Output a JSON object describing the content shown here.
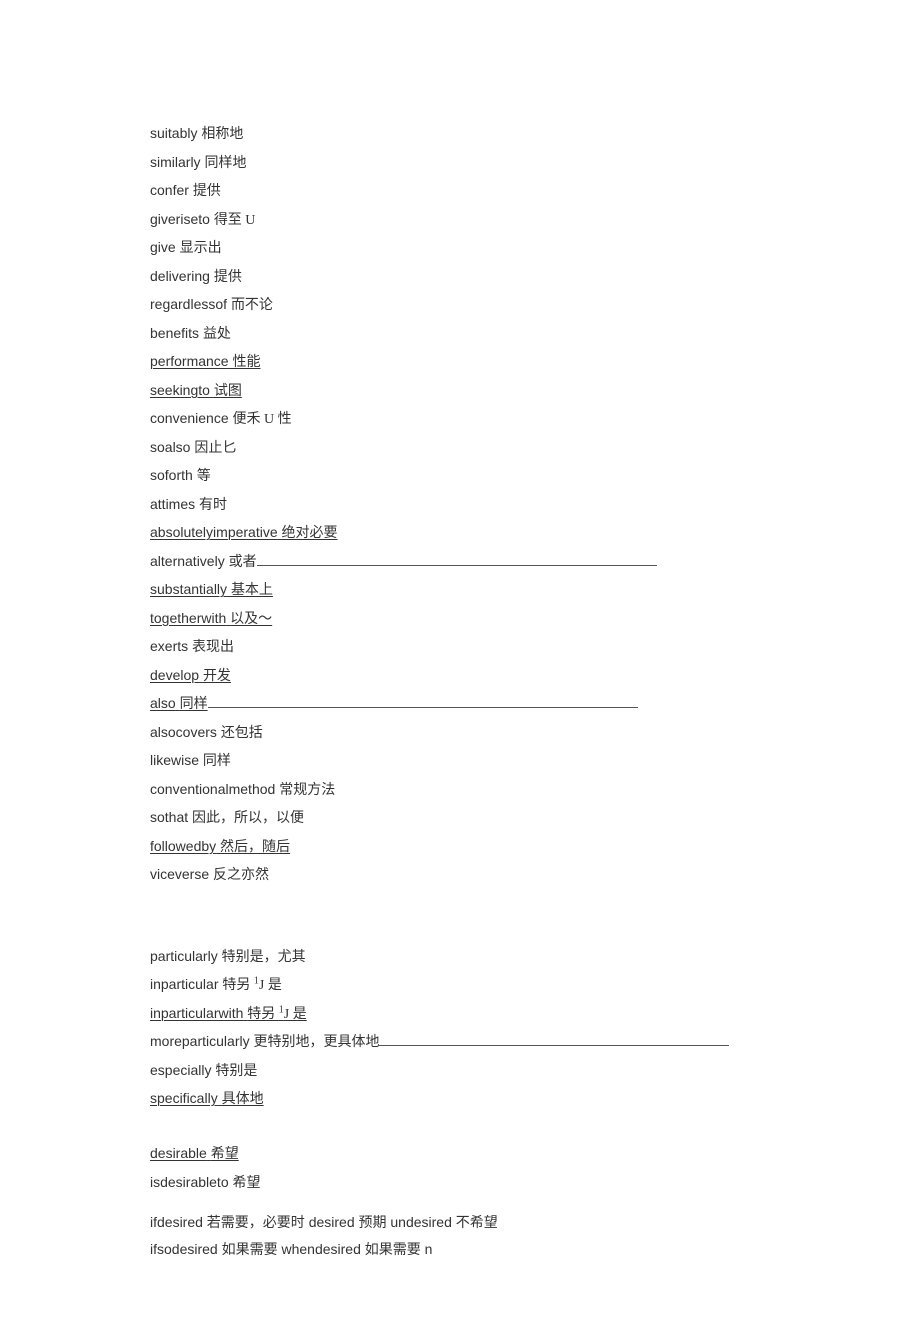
{
  "lines": [
    {
      "en": "suitably",
      "zh": "相称地",
      "ul": false,
      "fill": 0
    },
    {
      "en": "similarly",
      "zh": "同样地",
      "ul": false,
      "fill": 0
    },
    {
      "en": "confer",
      "zh": "提供",
      "ul": false,
      "fill": 0
    },
    {
      "en": "giveriseto",
      "zh": "得至 U",
      "ul": false,
      "fill": 0
    },
    {
      "en": "give",
      "zh": "显示出",
      "ul": false,
      "fill": 0
    },
    {
      "en": "delivering",
      "zh": "提供",
      "ul": false,
      "fill": 0
    },
    {
      "en": "regardlessof",
      "zh": "而不论",
      "ul": false,
      "fill": 0
    },
    {
      "en": "benefits",
      "zh": "益处",
      "ul": false,
      "fill": 0
    },
    {
      "en": "performance",
      "zh": "性能",
      "ul": true,
      "fill": 0
    },
    {
      "en": "seekingto",
      "zh": "试图",
      "ul": true,
      "fill": 0
    },
    {
      "en": "convenience",
      "zh": "便禾 U 性",
      "ul": false,
      "fill": 0
    },
    {
      "en": "soalso",
      "zh": "因止匕",
      "ul": false,
      "fill": 0
    },
    {
      "en": "soforth",
      "zh": "等",
      "ul": false,
      "fill": 0
    },
    {
      "en": "attimes",
      "zh": "有时",
      "ul": false,
      "fill": 0
    },
    {
      "en": "absolutelyimperative",
      "zh": "绝对必要",
      "ul": true,
      "fill": 0
    },
    {
      "en": "alternatively",
      "zh": "或者",
      "ul": false,
      "fill": 400
    },
    {
      "en": "substantially",
      "zh": "基本上",
      "ul": true,
      "fill": 0
    },
    {
      "en": "togetherwith",
      "zh": "以及〜",
      "ul": true,
      "fill": 0
    },
    {
      "en": "exerts",
      "zh": "表现出",
      "ul": false,
      "fill": 0
    },
    {
      "en": "develop",
      "zh": "开发",
      "ul": true,
      "fill": 0
    },
    {
      "en": "also",
      "zh": "同样",
      "ul": true,
      "fill": 430
    },
    {
      "en": "alsocovers",
      "zh": "还包括",
      "ul": false,
      "fill": 0
    },
    {
      "en": "likewise",
      "zh": "同样",
      "ul": false,
      "fill": 0
    },
    {
      "en": "conventionalmethod",
      "zh": "常规方法",
      "ul": false,
      "fill": 0
    },
    {
      "en": "sothat",
      "zh": "因此，所以，以便",
      "ul": false,
      "fill": 0
    },
    {
      "en": "followedby",
      "zh": "然后，随后",
      "ul": true,
      "fill": 0
    },
    {
      "en": "viceverse",
      "zh": "反之亦然",
      "ul": false,
      "fill": 0
    },
    {
      "gap": true
    },
    {
      "gap": true
    },
    {
      "en": "particularly",
      "zh": "特别是，尤其",
      "ul": false,
      "fill": 0
    },
    {
      "en": "inparticular",
      "zh_html": "特另 <span class='sup'>1</span>J 是",
      "ul": false,
      "fill": 0
    },
    {
      "en": "inparticularwith",
      "zh_html": "特另 <span class='sup'>1</span>J 是",
      "ul": true,
      "fill": 0
    },
    {
      "en": "moreparticularly",
      "zh": "更特别地，更具体地",
      "ul": false,
      "fill": 350
    },
    {
      "en": "especially",
      "zh": "特别是",
      "ul": false,
      "fill": 0
    },
    {
      "en": "specifically",
      "zh": "具体地",
      "ul": true,
      "fill": 0
    },
    {
      "gap": true
    },
    {
      "en": "desirable",
      "zh": "希望",
      "ul": true,
      "fill": 0
    },
    {
      "en": "isdesirableto",
      "zh": "希望",
      "ul": false,
      "fill": 0
    },
    {
      "half_gap": true
    },
    {
      "full": "ifdesired 若需要，必要时 desired 预期 undesired 不希望",
      "ul": false,
      "fill": 0
    },
    {
      "full": "ifsodesired 如果需要 whendesired 如果需要 n",
      "ul": false,
      "fill": 0
    }
  ]
}
